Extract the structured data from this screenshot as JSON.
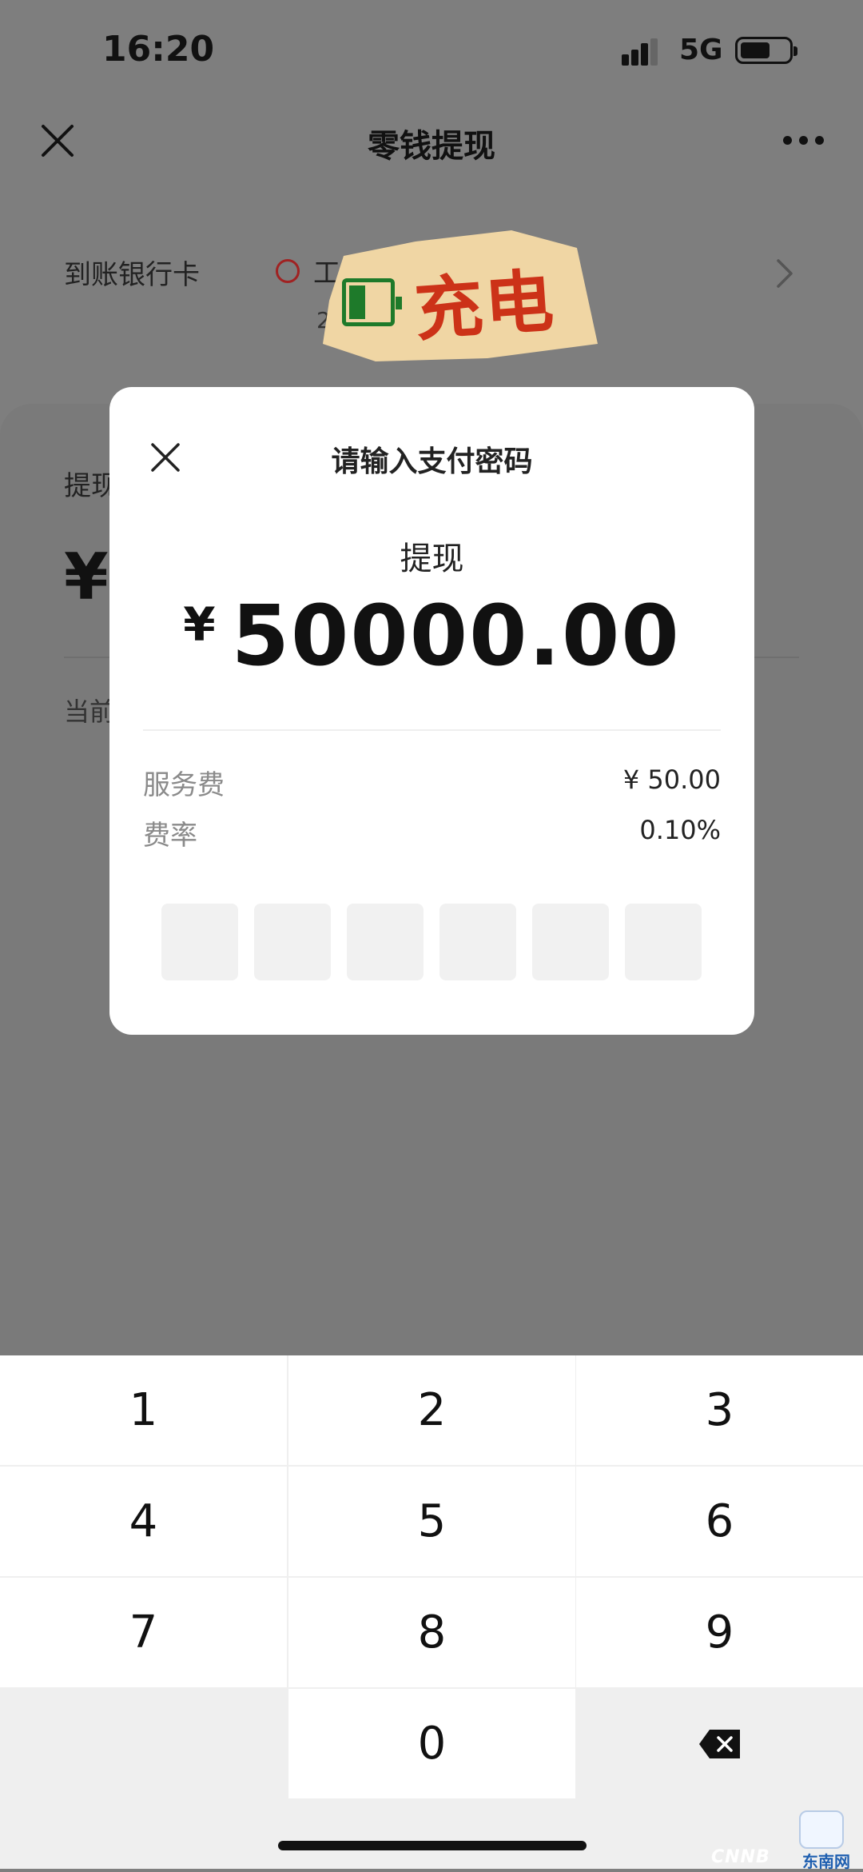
{
  "status_bar": {
    "time": "16:20",
    "network": "5G",
    "signal_icon": "signal-bars-icon",
    "battery_icon": "battery-icon"
  },
  "nav": {
    "title": "零钱提现",
    "close_icon": "close-icon",
    "more_icon": "more-dots-icon"
  },
  "bank_card": {
    "label": "到账银行卡",
    "bank_name_partial": "工",
    "bank_sub_partial": "2",
    "bank_icon": "bank-logo-icon",
    "chevron_icon": "chevron-right-icon"
  },
  "sticker": {
    "text": "充电",
    "icon": "battery-charging-icon"
  },
  "sheet": {
    "label_partial": "提现",
    "currency_symbol": "¥",
    "balance_partial": "当前"
  },
  "modal": {
    "title": "请输入支付密码",
    "subtitle": "提现",
    "currency_symbol": "¥",
    "amount": "50000.00",
    "fee_label": "服务费",
    "fee_value": "¥ 50.00",
    "rate_label": "费率",
    "rate_value": "0.10%",
    "pin_length": 6
  },
  "keypad": {
    "keys": [
      "1",
      "2",
      "3",
      "4",
      "5",
      "6",
      "7",
      "8",
      "9",
      "0"
    ],
    "delete_icon": "backspace-icon"
  },
  "watermark": {
    "text": "CNNB",
    "site_text": "东南网"
  },
  "colors": {
    "overlay_gray": "#7e7e7e",
    "modal_bg": "#ffffff",
    "keypad_bg": "#efefef",
    "sticker_red": "#cc3218",
    "sticker_green": "#1e7a2a",
    "sticker_bg": "#f0d6a4"
  }
}
